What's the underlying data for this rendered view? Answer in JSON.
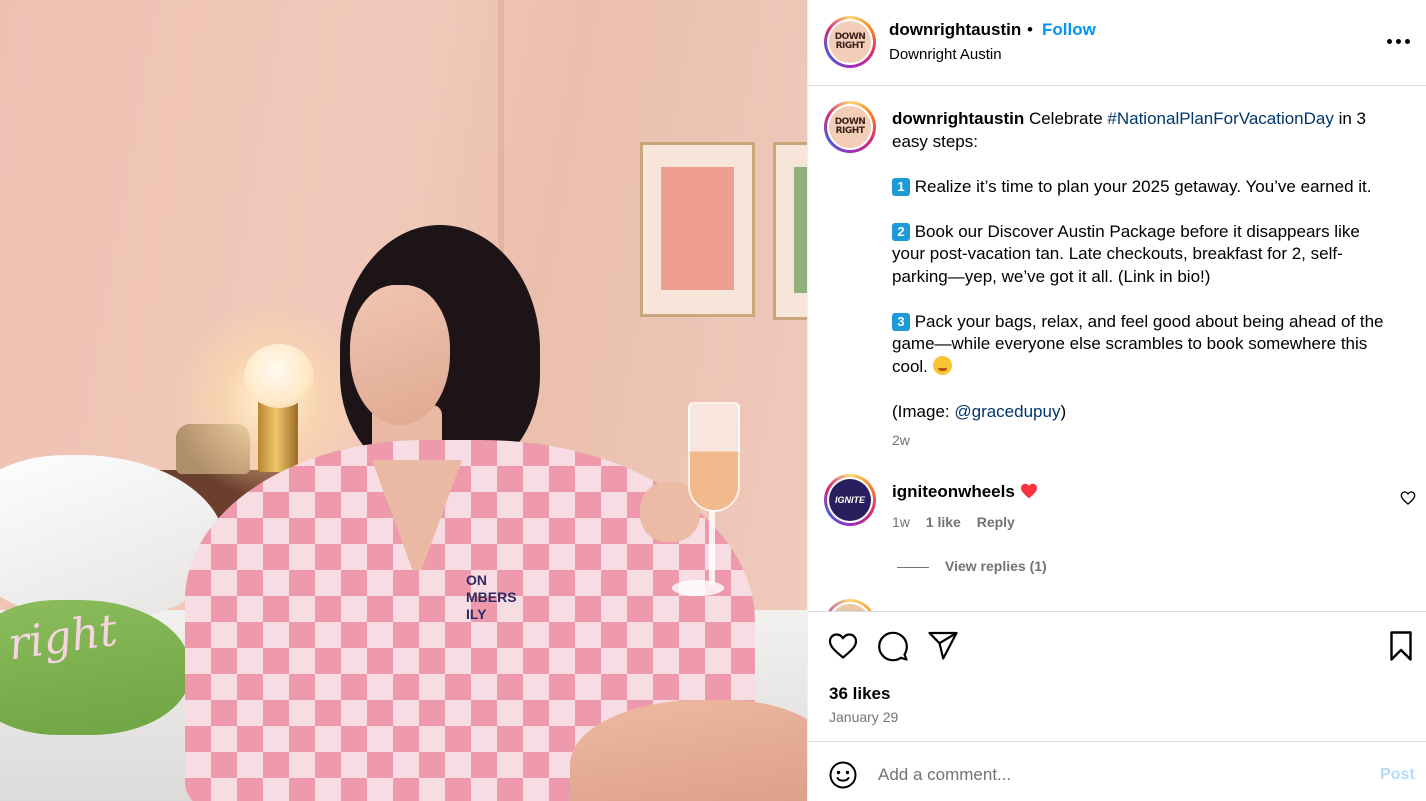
{
  "photo": {
    "robe_text": [
      "ON",
      "MBERS",
      "ILY"
    ],
    "pillow_text": "right",
    "alt": ""
  },
  "header": {
    "avatar_logo": [
      "DOWN",
      "RIGHT"
    ],
    "username": "downrightaustin",
    "separator": "•",
    "follow_label": "Follow",
    "location": "Downright Austin",
    "more_icon": "more-horizontal-icon"
  },
  "caption": {
    "username": "downrightaustin",
    "intro": " Celebrate ",
    "hashtag": "#NationalPlanForVacationDay",
    "intro_end": " in 3 easy steps:",
    "step1_num": "1",
    "step1": " Realize it’s time to plan your 2025 getaway. You’ve earned it.",
    "step2_num": "2",
    "step2": " Book our Discover Austin Package before it disappears like your post-vacation tan. Late checkouts, breakfast for 2, self-parking—yep, we’ve got it all. (Link in bio!)",
    "step3_num": "3",
    "step3": " Pack your bags, relax, and feel good about being ahead of the game—while everyone else scrambles to book somewhere this cool. ",
    "credit_prefix": "(Image: ",
    "credit_handle": "@gracedupuy",
    "credit_suffix": ")",
    "time": "2w"
  },
  "comments": [
    {
      "username": "igniteonwheels",
      "avatar_text": "IGNITE",
      "emoji": "red-heart-icon",
      "time": "1w",
      "likes": "1 like",
      "reply": "Reply"
    }
  ],
  "view_replies": "View replies (1)",
  "actions": {
    "likes": "36 likes",
    "date": "January 29",
    "icons": [
      "heart-icon",
      "comment-icon",
      "share-icon",
      "bookmark-icon"
    ]
  },
  "add_comment": {
    "placeholder": "Add a comment...",
    "post_label": "Post"
  },
  "colors": {
    "link": "#00376b",
    "follow": "#0095f6",
    "muted": "#737373",
    "post_disabled": "#b3dbff",
    "heart_red": "#ff3040"
  }
}
